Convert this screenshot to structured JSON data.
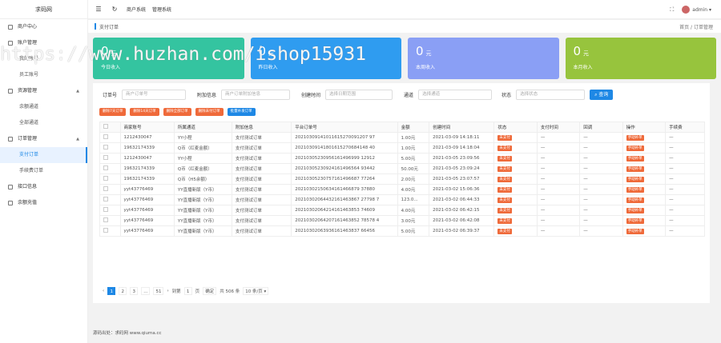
{
  "app": {
    "logo": "求码网"
  },
  "sidebar": {
    "items": [
      {
        "label": "商户中心",
        "caret": ""
      },
      {
        "label": "账户管理",
        "caret": ""
      },
      {
        "label": "我的账号",
        "sub": true
      },
      {
        "label": "员工账号",
        "sub": true
      },
      {
        "label": "资源管理",
        "caret": "▲"
      },
      {
        "label": "余额通道",
        "sub": true
      },
      {
        "label": "全部通道",
        "sub": true
      },
      {
        "label": "订单管理",
        "caret": "▲"
      },
      {
        "label": "支付订单",
        "sub": true,
        "active": true
      },
      {
        "label": "手续费订单",
        "sub": true
      },
      {
        "label": "接口信息",
        "caret": ""
      },
      {
        "label": "余额充值",
        "caret": ""
      }
    ]
  },
  "topbar": {
    "menu_icon": "☰",
    "refresh_icon": "↻",
    "links": [
      "商户系统",
      "管理系统"
    ],
    "fullscreen_icon": "⛶",
    "user": "admin ▾"
  },
  "breadcrumb": {
    "title": "支付订单",
    "home": "首页",
    "sep": "/",
    "current": "订单管理"
  },
  "stats": [
    {
      "value": "0",
      "unit": "元",
      "label": "今日收入",
      "color": "#34c4a0"
    },
    {
      "value": "0",
      "unit": "元",
      "label": "昨日收入",
      "color": "#2f9cf0"
    },
    {
      "value": "0",
      "unit": "元",
      "label": "本周收入",
      "color": "#8a9ff5"
    },
    {
      "value": "0",
      "unit": "元",
      "label": "本月收入",
      "color": "#97c43d"
    }
  ],
  "watermark": "https://www.huzhan.com/ishop15931",
  "filters": {
    "order_label": "订单号",
    "order_ph": "商户订单号",
    "extra_label": "附加信息",
    "extra_ph": "商户订单附加信息",
    "time_label": "创建时间",
    "time_ph": "选择日期范围",
    "channel_label": "通道",
    "channel_ph": "选择通道",
    "status_label": "状态",
    "status_ph": "选择状态",
    "search": "查询"
  },
  "actions": [
    {
      "label": "删除7天订单",
      "color": "#ef6a3a"
    },
    {
      "label": "删除14天订单",
      "color": "#ef6a3a"
    },
    {
      "label": "删除全部订单",
      "color": "#ef6a3a"
    },
    {
      "label": "删除未付订单",
      "color": "#ef6a3a"
    },
    {
      "label": "批量补发订单",
      "color": "#1e88e5"
    }
  ],
  "table": {
    "headers": [
      "",
      "商家账号",
      "所属通道",
      "附加信息",
      "平台订单号",
      "金额",
      "创建时间",
      "状态",
      "支付时间",
      "回调",
      "操作",
      "手续费"
    ],
    "rows": [
      [
        "",
        "1212430047",
        "YY小程",
        "支付测试订单",
        "20210309141011615270091207 97",
        "1.00元",
        "2021-03-09 14:18:11",
        "未支付",
        "—",
        "—",
        "手动补单",
        "—"
      ],
      [
        "",
        "19632174339",
        "Q币（红麦金额）",
        "支付测试订单",
        "20210309141801615270684148 40",
        "1.00元",
        "2021-03-09 14:18:04",
        "未支付",
        "—",
        "—",
        "手动补单",
        "—"
      ],
      [
        "",
        "1212430047",
        "YY小程",
        "支付测试订单",
        "20210305230956161496999 12912",
        "5.00元",
        "2021-03-05 23:09:56",
        "未支付",
        "—",
        "—",
        "手动补单",
        "—"
      ],
      [
        "",
        "19632174339",
        "Q币（红麦金额）",
        "支付测试订单",
        "20210305230924161496564 93442",
        "50.00元",
        "2021-03-05 23:09:24",
        "未支付",
        "—",
        "—",
        "手动补单",
        "—"
      ],
      [
        "",
        "19632174339",
        "Q币（H5余额）",
        "支付测试订单",
        "20210305230757161496687 77264",
        "2.00元",
        "2021-03-05 23:07:57",
        "未支付",
        "—",
        "—",
        "手动补单",
        "—"
      ],
      [
        "",
        "yyt43776469",
        "YY直播新版（Y币）",
        "支付测试订单",
        "20210302150634161466879 37880",
        "4.00元",
        "2021-03-02 15:06:36",
        "未支付",
        "—",
        "—",
        "手动补单",
        "—"
      ],
      [
        "",
        "yyt43776469",
        "YY直播新版（Y币）",
        "支付测试订单",
        "20210302064432161463867 27798 7",
        "123.0...",
        "2021-03-02 06:44:33",
        "未支付",
        "—",
        "—",
        "手动补单",
        "—"
      ],
      [
        "",
        "yyt43776469",
        "YY直播新版（Y币）",
        "支付测试订单",
        "20210302064214161463853 74609",
        "4.00元",
        "2021-03-02 06:42:15",
        "未支付",
        "—",
        "—",
        "手动补单",
        "—"
      ],
      [
        "",
        "yyt43776469",
        "YY直播新版（Y币）",
        "支付测试订单",
        "20210302064207161463852 78578 4",
        "3.00元",
        "2021-03-02 06:42:08",
        "未支付",
        "—",
        "—",
        "手动补单",
        "—"
      ],
      [
        "",
        "yyt43776469",
        "YY直播新版（Y币）",
        "支付测试订单",
        "20210302063936161463837 66456",
        "5.00元",
        "2021-03-02 06:39:37",
        "未支付",
        "—",
        "—",
        "手动补单",
        "—"
      ]
    ]
  },
  "pager": {
    "prev": "‹",
    "pages": [
      "1",
      "2",
      "3",
      "...",
      "51"
    ],
    "next": "›",
    "goto": "到第",
    "page_val": "1",
    "page_unit": "页",
    "confirm": "确定",
    "total": "共 506 条",
    "size": "10 条/页 ▾"
  },
  "footer": "源码出处：求码网 www.qiuma.cc"
}
